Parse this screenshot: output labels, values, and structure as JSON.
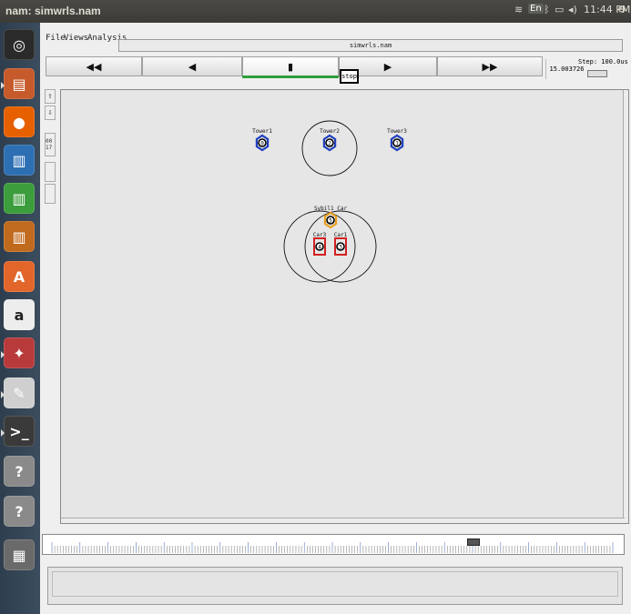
{
  "system_bar": {
    "window_title": "nam: simwrls.nam",
    "keyboard_indicator": "En",
    "clock": "11:44 PM"
  },
  "launcher": {
    "items": [
      {
        "name": "dash-home",
        "glyph": "◎",
        "color": "#2a2a2a"
      },
      {
        "name": "files",
        "glyph": "▤",
        "color": "#c65a2a"
      },
      {
        "name": "firefox",
        "glyph": "●",
        "color": "#e66000"
      },
      {
        "name": "libreoffice-writer",
        "glyph": "▥",
        "color": "#2d6fb3"
      },
      {
        "name": "libreoffice-calc",
        "glyph": "▥",
        "color": "#3c9d3c"
      },
      {
        "name": "libreoffice-impress",
        "glyph": "▥",
        "color": "#c06a1e"
      },
      {
        "name": "software-center",
        "glyph": "A",
        "color": "#e2652a"
      },
      {
        "name": "amazon",
        "glyph": "a",
        "color": "#ededed"
      },
      {
        "name": "system-settings",
        "glyph": "✦",
        "color": "#b83a3a"
      },
      {
        "name": "text-editor",
        "glyph": "✎",
        "color": "#cfcfcf"
      },
      {
        "name": "terminal",
        "glyph": ">_",
        "color": "#3a3a3a"
      },
      {
        "name": "unknown-app-1",
        "glyph": "?",
        "color": "#8a8a8a"
      },
      {
        "name": "unknown-app-2",
        "glyph": "?",
        "color": "#8a8a8a"
      },
      {
        "name": "workspace-switcher",
        "glyph": "▦",
        "color": "#6a6a6a"
      }
    ]
  },
  "menubar": {
    "file": "File",
    "views": "Views",
    "analysis": "Analysis",
    "filename": "simwrls.nam"
  },
  "controls": {
    "rewind": "◀◀",
    "back": "◀",
    "stop": "▮",
    "play": "▶",
    "fast_forward": "▶▶",
    "tooltip": "stop",
    "time": "15.003726",
    "step": "Step: 100.0us"
  },
  "tools": {
    "zoom_in": "⇧",
    "zoom_out": "⇩",
    "text": "00 17"
  },
  "nodes": [
    {
      "label": "Tower1",
      "id": "0",
      "type": "tower",
      "color": "#1f3fbf"
    },
    {
      "label": "Tower2",
      "id": "2",
      "type": "tower",
      "color": "#1f3fbf"
    },
    {
      "label": "Tower3",
      "id": "1",
      "type": "tower",
      "color": "#1f3fbf"
    },
    {
      "label": "Sybil1_Car",
      "id": "5",
      "type": "sybil",
      "color": "#e8a020"
    },
    {
      "label": "Car3",
      "id": "4",
      "type": "car",
      "color": "#d42020"
    },
    {
      "label": "Car1",
      "id": "3",
      "type": "car",
      "color": "#d42020"
    }
  ]
}
